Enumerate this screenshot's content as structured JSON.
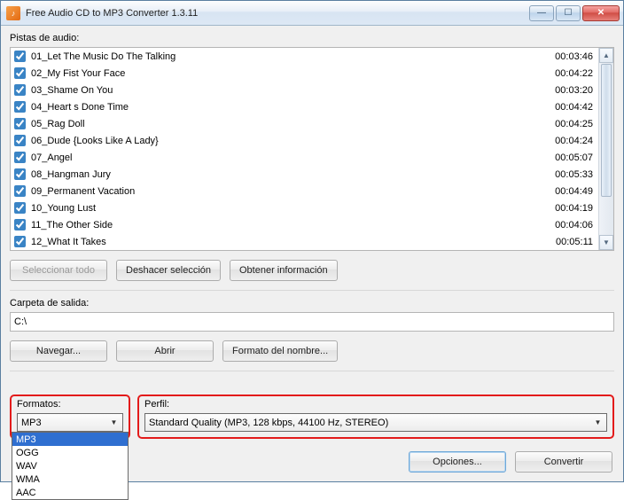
{
  "window": {
    "title": "Free Audio CD to MP3 Converter 1.3.11"
  },
  "tracks": {
    "label": "Pistas de audio:",
    "items": [
      {
        "checked": true,
        "name": "01_Let The Music Do The Talking",
        "duration": "00:03:46"
      },
      {
        "checked": true,
        "name": "02_My Fist Your Face",
        "duration": "00:04:22"
      },
      {
        "checked": true,
        "name": "03_Shame On You",
        "duration": "00:03:20"
      },
      {
        "checked": true,
        "name": "04_Heart s Done Time",
        "duration": "00:04:42"
      },
      {
        "checked": true,
        "name": "05_Rag Doll",
        "duration": "00:04:25"
      },
      {
        "checked": true,
        "name": "06_Dude {Looks Like A Lady}",
        "duration": "00:04:24"
      },
      {
        "checked": true,
        "name": "07_Angel",
        "duration": "00:05:07"
      },
      {
        "checked": true,
        "name": "08_Hangman Jury",
        "duration": "00:05:33"
      },
      {
        "checked": true,
        "name": "09_Permanent Vacation",
        "duration": "00:04:49"
      },
      {
        "checked": true,
        "name": "10_Young Lust",
        "duration": "00:04:19"
      },
      {
        "checked": true,
        "name": "11_The Other Side",
        "duration": "00:04:06"
      },
      {
        "checked": true,
        "name": "12_What It Takes",
        "duration": "00:05:11"
      }
    ]
  },
  "buttons": {
    "select_all": "Seleccionar todo",
    "undo_selection": "Deshacer selección",
    "get_info": "Obtener información",
    "browse": "Navegar...",
    "open": "Abrir",
    "name_format": "Formato del nombre...",
    "options": "Opciones...",
    "convert": "Convertir"
  },
  "output": {
    "label": "Carpeta de salida:",
    "path": "C:\\"
  },
  "formats": {
    "label": "Formatos:",
    "selected": "MP3",
    "options": [
      "MP3",
      "OGG",
      "WAV",
      "WMA",
      "AAC"
    ],
    "highlighted": "MP3"
  },
  "profile": {
    "label": "Perfil:",
    "selected": "Standard Quality (MP3, 128 kbps, 44100 Hz, STEREO)"
  }
}
